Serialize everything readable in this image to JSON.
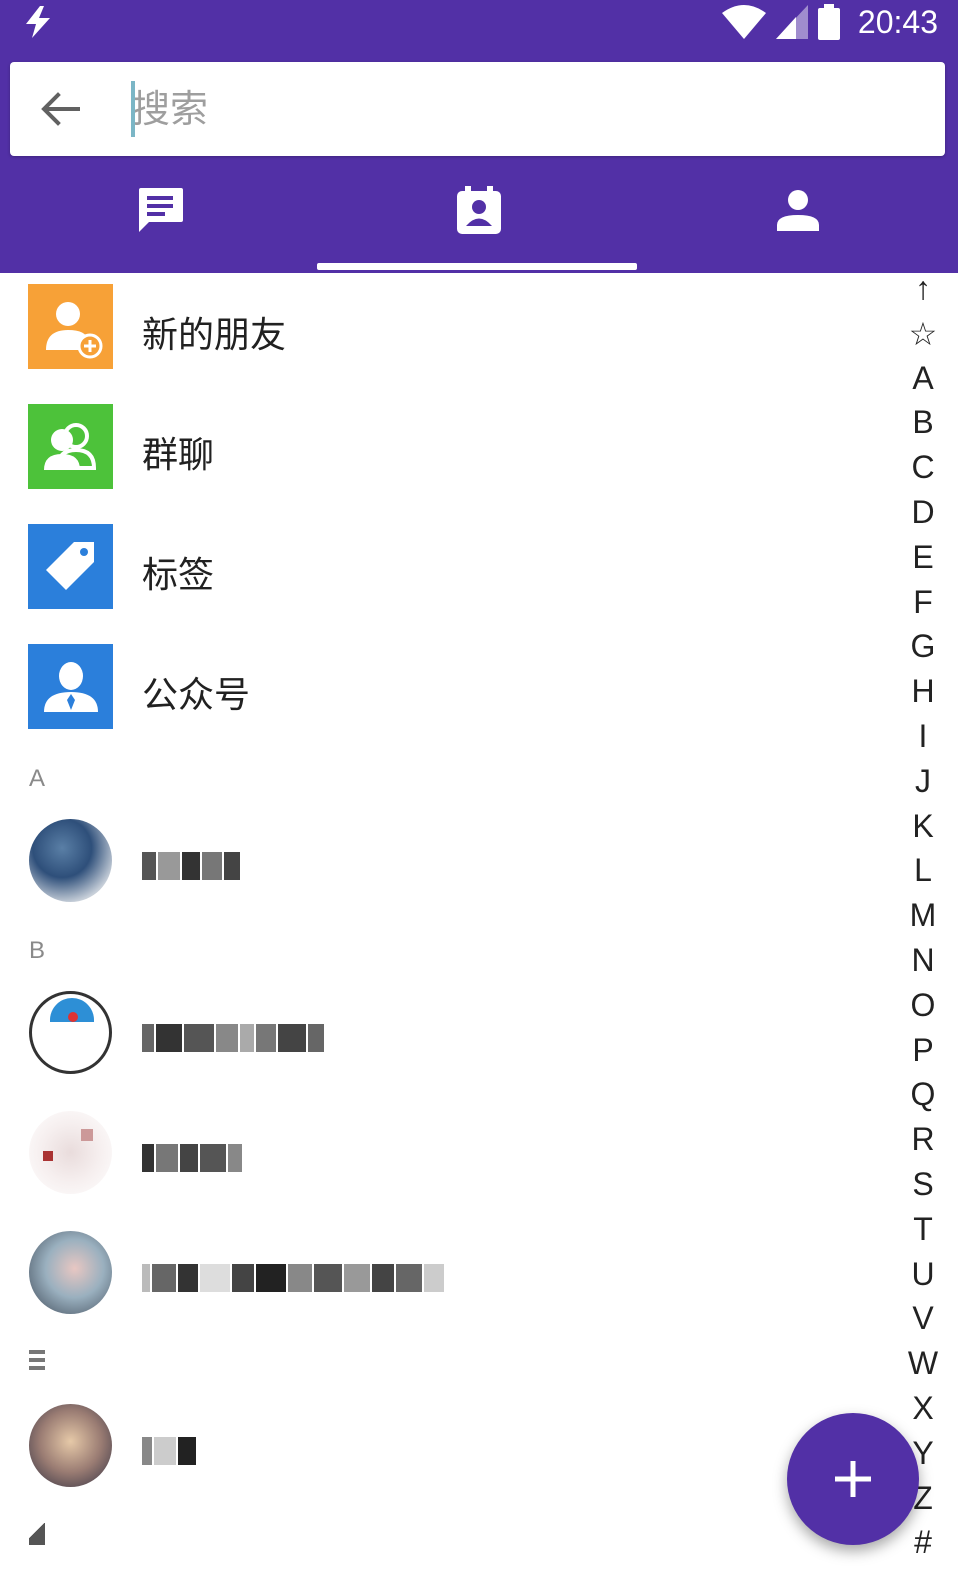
{
  "status_bar": {
    "time": "20:43"
  },
  "search": {
    "placeholder": "搜索"
  },
  "tabs": [
    {
      "name": "messages",
      "icon": "chat-icon"
    },
    {
      "name": "contacts",
      "icon": "contacts-icon",
      "active": true
    },
    {
      "name": "me",
      "icon": "person-icon"
    }
  ],
  "features": [
    {
      "label": "新的朋友",
      "icon": "add-friend-icon",
      "color": "#F7A137"
    },
    {
      "label": "群聊",
      "icon": "group-chat-icon",
      "color": "#4DC23A"
    },
    {
      "label": "标签",
      "icon": "tag-icon",
      "color": "#2B7FDB"
    },
    {
      "label": "公众号",
      "icon": "official-account-icon",
      "color": "#2B7FDB"
    }
  ],
  "sections": {
    "a": "A",
    "b": "B"
  },
  "index_letters": [
    "↑",
    "☆",
    "A",
    "B",
    "C",
    "D",
    "E",
    "F",
    "G",
    "H",
    "I",
    "J",
    "K",
    "L",
    "M",
    "N",
    "O",
    "P",
    "Q",
    "R",
    "S",
    "T",
    "U",
    "V",
    "W",
    "X",
    "Y",
    "Z",
    "#"
  ],
  "fab": {
    "icon": "plus-icon"
  },
  "colors": {
    "primary": "#5230A6",
    "accent": "#5230A6"
  }
}
